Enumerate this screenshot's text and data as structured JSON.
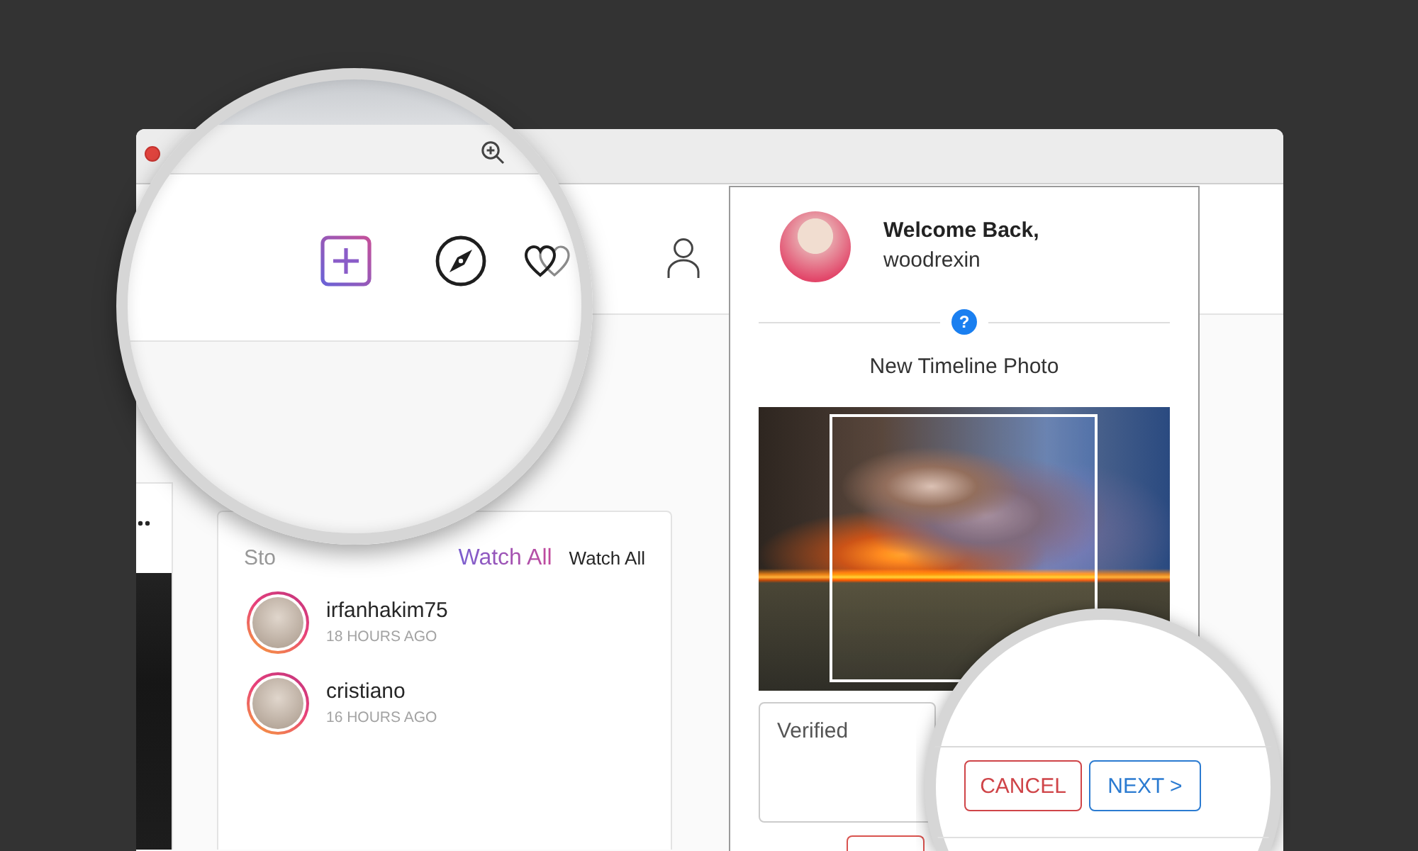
{
  "stories": {
    "title": "Sto",
    "links": [
      {
        "label": "Watch All",
        "kind": "gradient"
      },
      {
        "label": "Watch All",
        "kind": "plain"
      }
    ],
    "items": [
      {
        "username": "irfanhakim75",
        "time": "18 HOURS AGO"
      },
      {
        "username": "cristiano",
        "time": "16 HOURS AGO"
      }
    ]
  },
  "upload_panel": {
    "greeting": "Welcome Back,",
    "username": "woodrexin",
    "help_badge": "?",
    "title": "New Timeline Photo",
    "caption": {
      "value": "Verified"
    }
  },
  "magnifier": {
    "buttons": [
      {
        "label": "CANCEL",
        "kind": "danger"
      },
      {
        "label": "NEXT >",
        "kind": "primary"
      }
    ]
  }
}
